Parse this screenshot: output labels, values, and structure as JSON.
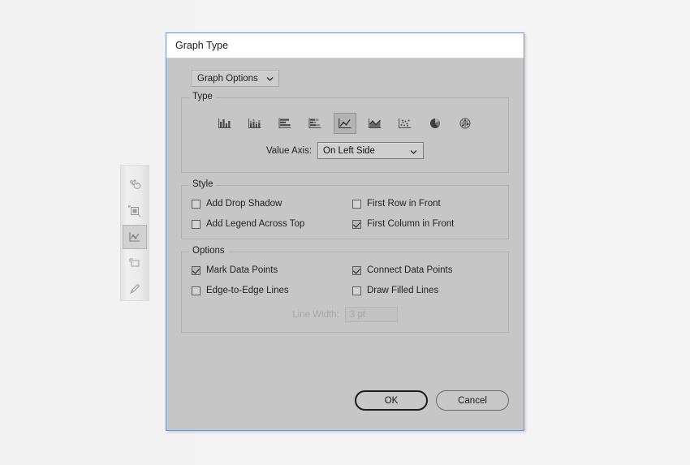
{
  "window": {
    "title": "Graph Type"
  },
  "section_selector": {
    "name": "graph-options-select",
    "value": "Graph Options",
    "caret_icon": "chevron-down-icon"
  },
  "type_group": {
    "legend": "Type",
    "buttons": [
      {
        "icon": "column-graph-icon",
        "label": "Column Graph",
        "selected": false
      },
      {
        "icon": "stacked-column-graph-icon",
        "label": "Stacked Column Graph",
        "selected": false
      },
      {
        "icon": "bar-graph-icon",
        "label": "Bar Graph",
        "selected": false
      },
      {
        "icon": "stacked-bar-graph-icon",
        "label": "Stacked Bar Graph",
        "selected": false
      },
      {
        "icon": "line-graph-icon",
        "label": "Line Graph",
        "selected": true
      },
      {
        "icon": "area-graph-icon",
        "label": "Area Graph",
        "selected": false
      },
      {
        "icon": "scatter-graph-icon",
        "label": "Scatter Graph",
        "selected": false
      },
      {
        "icon": "pie-graph-icon",
        "label": "Pie Graph",
        "selected": false
      },
      {
        "icon": "radar-graph-icon",
        "label": "Radar Graph",
        "selected": false
      }
    ],
    "value_axis": {
      "label": "Value Axis:",
      "value": "On Left Side",
      "caret_icon": "chevron-down-icon"
    }
  },
  "style_group": {
    "legend": "Style",
    "checkboxes": [
      {
        "label": "Add Drop Shadow",
        "checked": false,
        "disabled": false
      },
      {
        "label": "First Row in Front",
        "checked": false,
        "disabled": false
      },
      {
        "label": "Add Legend Across Top",
        "checked": false,
        "disabled": false
      },
      {
        "label": "First Column in Front",
        "checked": true,
        "disabled": false
      }
    ]
  },
  "options_group": {
    "legend": "Options",
    "checkboxes": [
      {
        "label": "Mark Data Points",
        "checked": true,
        "disabled": false
      },
      {
        "label": "Connect Data Points",
        "checked": true,
        "disabled": false
      },
      {
        "label": "Edge-to-Edge Lines",
        "checked": false,
        "disabled": false
      },
      {
        "label": "Draw Filled Lines",
        "checked": false,
        "disabled": false
      }
    ],
    "line_width": {
      "label": "Line Width:",
      "value": "3 pt",
      "disabled": true
    }
  },
  "footer": {
    "ok_label": "OK",
    "cancel_label": "Cancel"
  },
  "tool_panel": {
    "tools": [
      {
        "icon": "symbol-sprayer-tool-icon",
        "selected": false
      },
      {
        "icon": "column-graph-tool-icon",
        "selected": false
      },
      {
        "icon": "line-graph-tool-icon",
        "selected": true
      },
      {
        "icon": "artboard-tool-icon",
        "selected": false
      },
      {
        "icon": "slice-tool-icon",
        "selected": false
      }
    ]
  },
  "colors": {
    "dialog_border": "#6f93c7",
    "dialog_bg": "#c6c6c6",
    "titlebar_bg": "#ffffff",
    "focus_border": "#5b7fb5",
    "canvas_bg": "#f2f2f2"
  }
}
